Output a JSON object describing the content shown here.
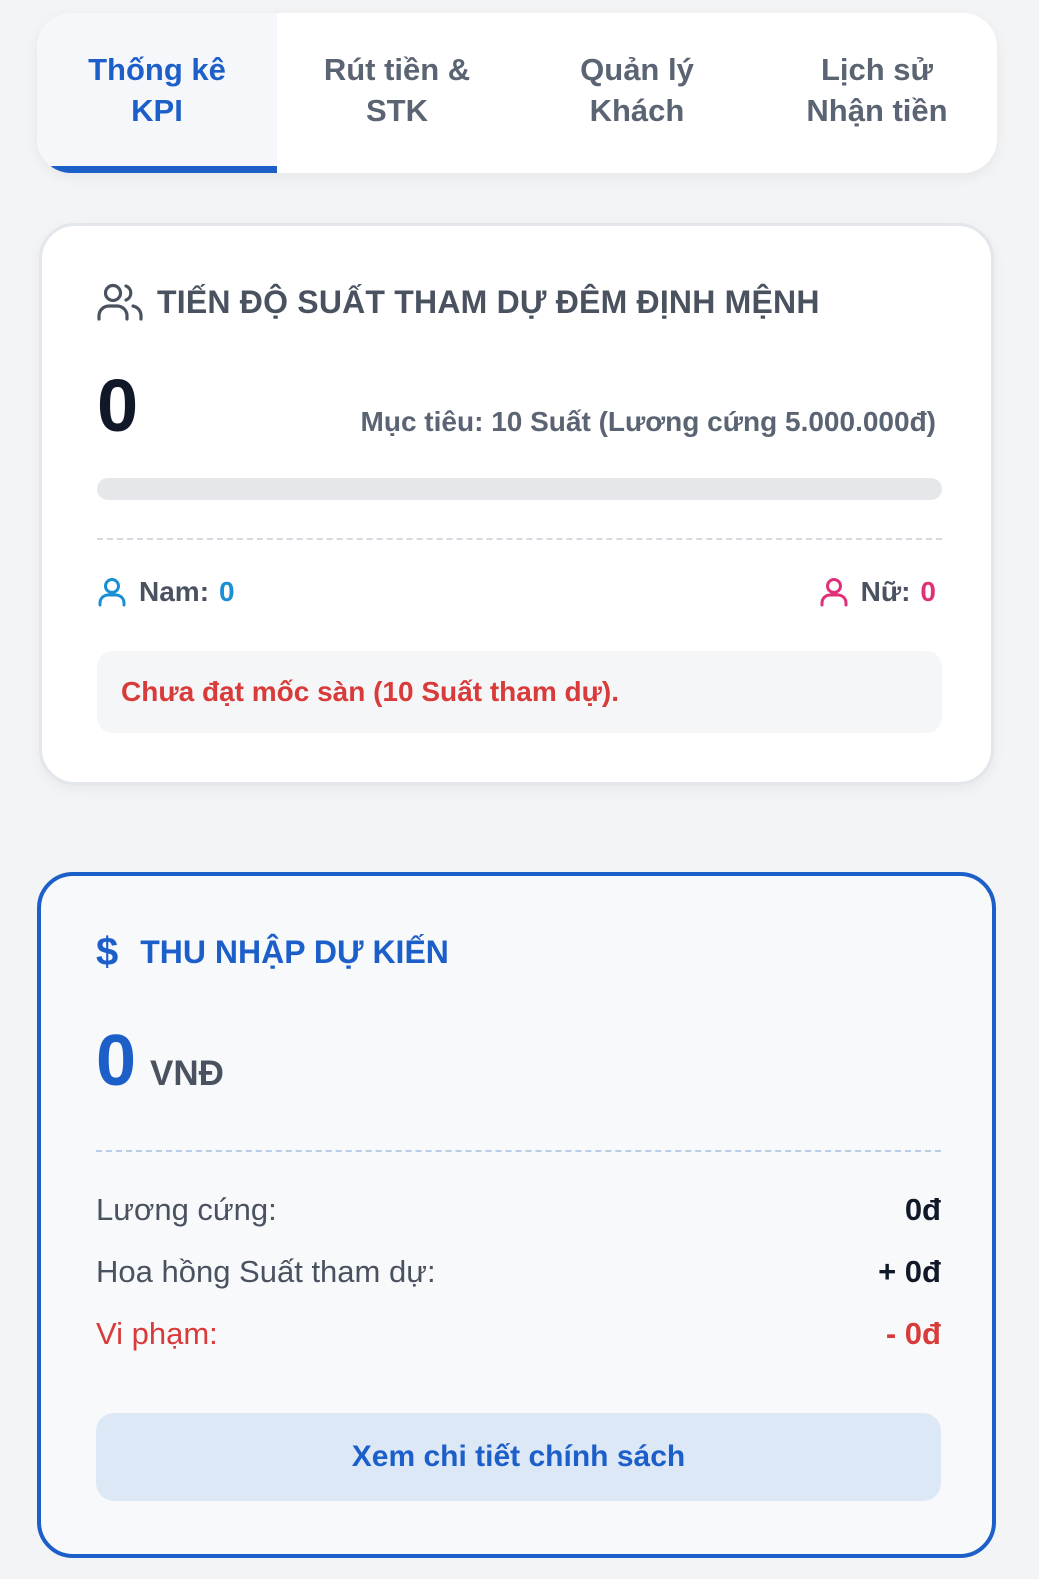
{
  "tabs": [
    {
      "label": "Thống kê\nKPI",
      "active": true
    },
    {
      "label": "Rút tiền &\nSTK",
      "active": false
    },
    {
      "label": "Quản lý\nKhách",
      "active": false
    },
    {
      "label": "Lịch sử\nNhận tiền",
      "active": false
    }
  ],
  "kpi": {
    "icon": "users-icon",
    "title": "TIẾN ĐỘ SUẤT THAM DỰ ĐÊM ĐỊNH MỆNH",
    "count": "0",
    "target": "Mục tiêu: 10 Suất (Lương cứng 5.000.000đ)",
    "progress_fraction": 0,
    "male_label": "Nam:",
    "male_value": "0",
    "female_label": "Nữ:",
    "female_value": "0",
    "warning": "Chưa đạt mốc sàn (10 Suất tham dự)."
  },
  "income": {
    "icon": "dollar-icon",
    "title": "THU NHẬP DỰ KIẾN",
    "amount": "0",
    "unit": "VNĐ",
    "rows": [
      {
        "label": "Lương cứng:",
        "value": "0đ"
      },
      {
        "label": "Hoa hồng Suất tham dự:",
        "value": "+ 0đ"
      },
      {
        "label": "Vi phạm:",
        "value": "- 0đ"
      }
    ],
    "button_label": "Xem chi tiết chính sách"
  },
  "colors": {
    "accent": "#1d5fc9",
    "male": "#1b8fd6",
    "female": "#e0307a",
    "danger": "#d93a3a"
  }
}
